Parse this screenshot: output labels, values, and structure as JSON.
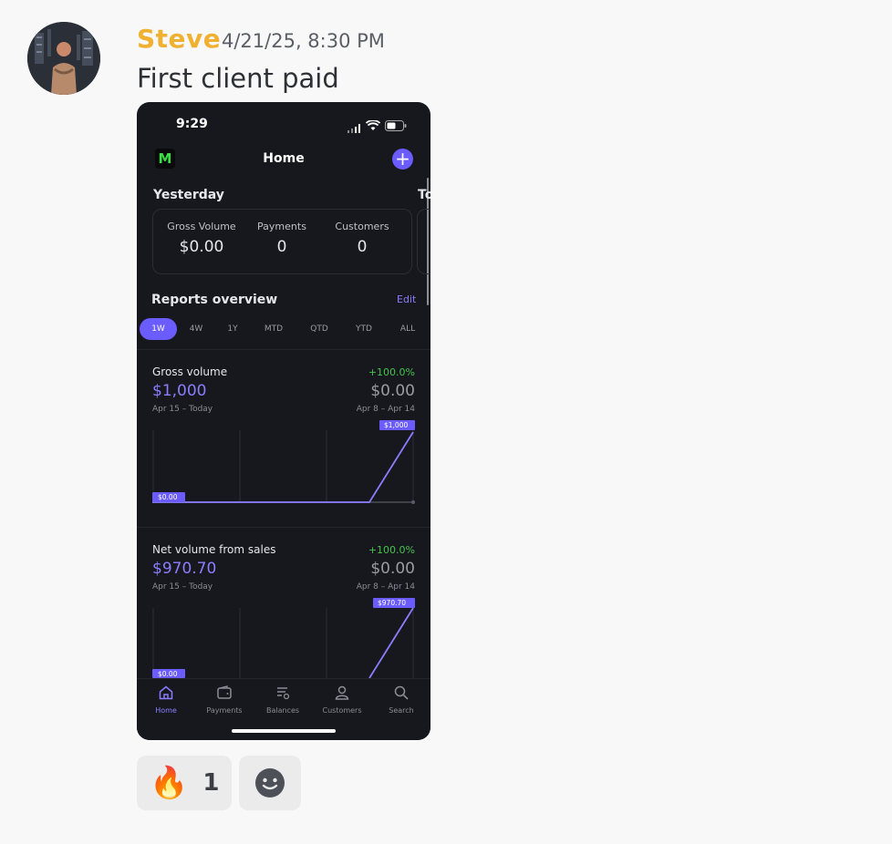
{
  "message": {
    "author": "Steve",
    "timestamp": "4/21/25, 8:30 PM",
    "text": "First client paid",
    "author_color": "#f0b132"
  },
  "phone": {
    "status_time": "9:29",
    "header": {
      "logo": "M",
      "title": "Home",
      "add_icon": "plus-icon"
    },
    "sections": [
      {
        "label": "Yesterday",
        "stats": [
          {
            "label": "Gross Volume",
            "value": "$0.00"
          },
          {
            "label": "Payments",
            "value": "0"
          },
          {
            "label": "Customers",
            "value": "0"
          }
        ]
      },
      {
        "label": "To"
      }
    ],
    "reports": {
      "title": "Reports overview",
      "edit": "Edit",
      "ranges": [
        "1W",
        "4W",
        "1Y",
        "MTD",
        "QTD",
        "YTD",
        "ALL"
      ],
      "active_range": "1W",
      "cards": [
        {
          "title": "Gross volume",
          "change": "+100.0%",
          "current": "$1,000",
          "previous": "$0.00",
          "current_range": "Apr 15 – Today",
          "previous_range": "Apr 8 – Apr 14",
          "end_label": "$1,000",
          "start_label": "$0.00"
        },
        {
          "title": "Net volume from sales",
          "change": "+100.0%",
          "current": "$970.70",
          "previous": "$0.00",
          "current_range": "Apr 15 – Today",
          "previous_range": "Apr 8 – Apr 14",
          "end_label": "$970.70",
          "start_label": "$0.00"
        }
      ]
    },
    "tabs": [
      {
        "label": "Home",
        "icon": "home-icon",
        "active": true
      },
      {
        "label": "Payments",
        "icon": "wallet-icon"
      },
      {
        "label": "Balances",
        "icon": "balances-icon"
      },
      {
        "label": "Customers",
        "icon": "person-icon"
      },
      {
        "label": "Search",
        "icon": "search-icon"
      }
    ],
    "accent": "#6b5cff",
    "positive": "#46c24d"
  },
  "reactions": [
    {
      "emoji": "🔥",
      "count": "1"
    },
    {
      "icon": "add-reaction-icon"
    }
  ]
}
